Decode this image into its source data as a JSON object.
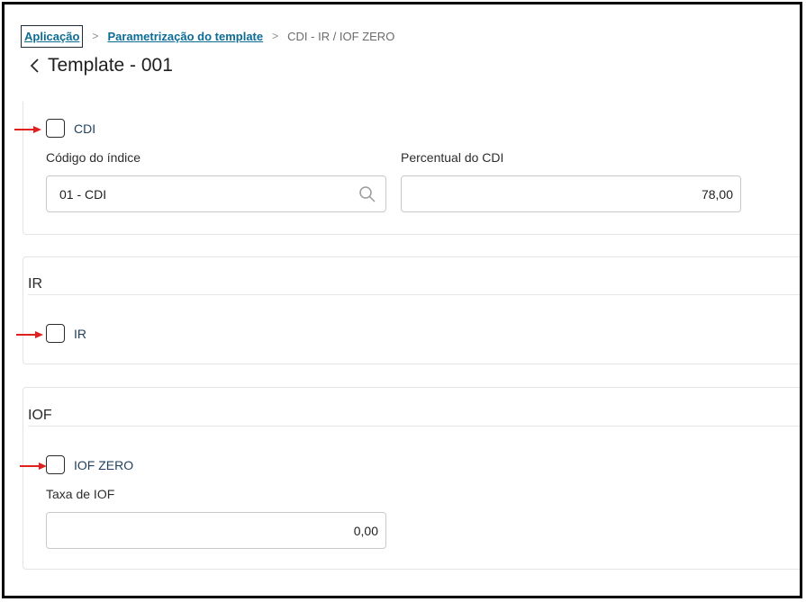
{
  "breadcrumb": {
    "items": [
      "Aplicação",
      "Parametrização do template"
    ],
    "current": "CDI - IR / IOF ZERO",
    "separator": ">"
  },
  "page": {
    "title": "Template - 001"
  },
  "cdi_section": {
    "checkbox_label": "CDI",
    "checked": false,
    "indice_label": "Código do índice",
    "indice_value": "01 - CDI",
    "percentual_label": "Percentual do CDI",
    "percentual_value": "78,00"
  },
  "ir_section": {
    "heading": "IR",
    "checkbox_label": "IR",
    "checked": false
  },
  "iof_section": {
    "heading": "IOF",
    "checkbox_label": "IOF ZERO",
    "checked": false,
    "taxa_label": "Taxa de IOF",
    "taxa_value": "0,00"
  },
  "colors": {
    "link": "#0c6c94",
    "checkbox_label": "#22415e",
    "annotation_arrow": "#e0201e",
    "border": "#c9c9c9"
  },
  "icons": {
    "back": "chevron-left-icon",
    "search": "search-icon",
    "annotation": "red-arrow-icon"
  }
}
